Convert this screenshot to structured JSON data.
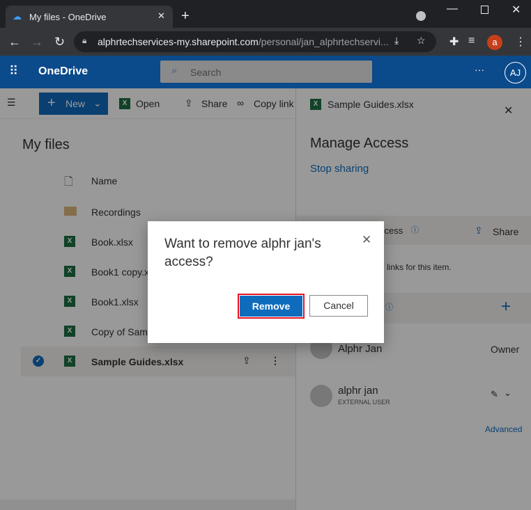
{
  "browser": {
    "tab_title": "My files - OneDrive",
    "url_host": "alphrtechservices-my.sharepoint.com",
    "url_path": "/personal/jan_alphrtechservi...",
    "profile_initial": "a"
  },
  "header": {
    "app_name": "OneDrive",
    "search_placeholder": "Search",
    "more": "···",
    "avatar": "AJ"
  },
  "toolbar": {
    "new": "New",
    "open": "Open",
    "share": "Share",
    "copy_link": "Copy link"
  },
  "main": {
    "title": "My files",
    "column_name": "Name",
    "files": [
      {
        "name": "Recordings",
        "type": "folder"
      },
      {
        "name": "Book.xlsx",
        "type": "xlsx"
      },
      {
        "name": "Book1 copy.x",
        "type": "xlsx"
      },
      {
        "name": "Book1.xlsx",
        "type": "xlsx"
      },
      {
        "name": "Copy of Samp",
        "type": "xlsx"
      },
      {
        "name": "Sample Guides.xlsx",
        "type": "xlsx",
        "selected": true
      }
    ]
  },
  "panel": {
    "file_name": "Sample Guides.xlsx",
    "title": "Manage Access",
    "stop_sharing": "Stop sharing",
    "links_header": "ccess",
    "share": "Share",
    "links_text": "links for this item.",
    "people": [
      {
        "name": "Alphr Jan",
        "role": "Owner"
      },
      {
        "name": "alphr jan",
        "sub": "EXTERNAL USER"
      }
    ],
    "advanced": "Advanced"
  },
  "dialog": {
    "title": "Want to remove alphr jan's access?",
    "remove": "Remove",
    "cancel": "Cancel"
  }
}
